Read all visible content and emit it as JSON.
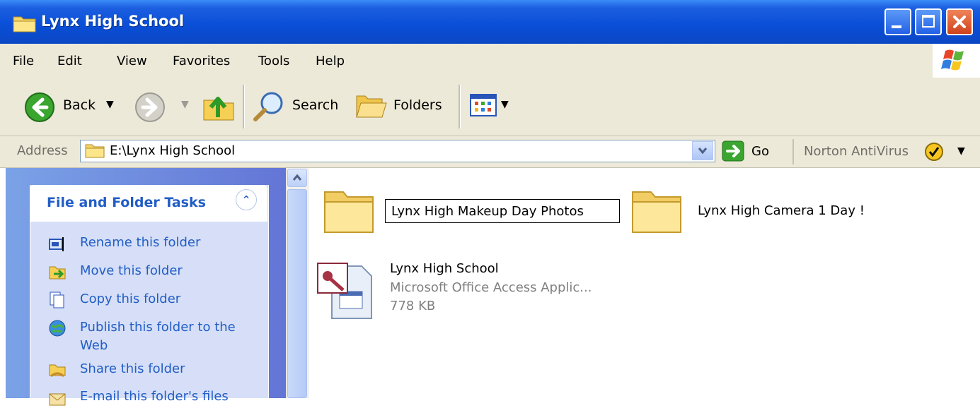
{
  "window": {
    "title": "Lynx High School"
  },
  "menu": [
    "File",
    "Edit",
    "View",
    "Favorites",
    "Tools",
    "Help"
  ],
  "toolbar": {
    "back_label": "Back",
    "search_label": "Search",
    "folders_label": "Folders"
  },
  "address": {
    "label": "Address",
    "value": "E:\\Lynx High School",
    "go_label": "Go",
    "norton_label": "Norton AntiVirus"
  },
  "tasks": {
    "title": "File and Folder Tasks",
    "items": [
      "Rename this folder",
      "Move this folder",
      "Copy this folder",
      "Publish this folder to the Web",
      "Share this folder",
      "E-mail this folder's files"
    ]
  },
  "content": {
    "items": [
      {
        "type": "folder",
        "name": "Lynx High Makeup Day Photos",
        "renaming": true
      },
      {
        "type": "folder",
        "name": "Lynx High Camera 1 Day !"
      },
      {
        "type": "file",
        "name": "Lynx High School",
        "kind": "Microsoft Office Access Applic...",
        "size": "778 KB"
      }
    ]
  }
}
